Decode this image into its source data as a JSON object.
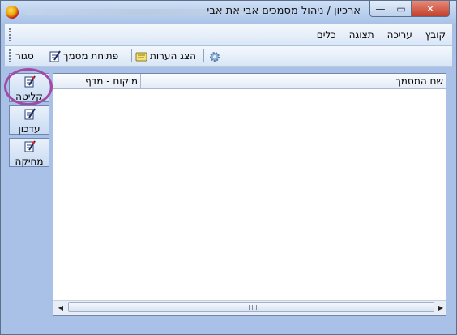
{
  "window": {
    "title": "ארכיון / ניהול מסמכים אבי את אבי",
    "minimize_glyph": "—",
    "maximize_glyph": "▭",
    "close_glyph": "✕"
  },
  "menu": {
    "items": [
      "קובץ",
      "עריכה",
      "תצוגה",
      "כלים"
    ]
  },
  "toolbar": {
    "close_label": "סגור",
    "open_document_label": "פתיחת מסמך",
    "show_notes_label": "הצג הערות"
  },
  "sidebar": {
    "intake_label": "קליטה",
    "update_label": "עדכון",
    "delete_label": "מחיקה"
  },
  "grid": {
    "columns": [
      "שם המסמך",
      "מיקום - מדף"
    ],
    "rows": []
  },
  "colors": {
    "window_bg": "#a9c1e6",
    "highlight_circle": "#a24aa6",
    "close_button": "#c2402b"
  }
}
